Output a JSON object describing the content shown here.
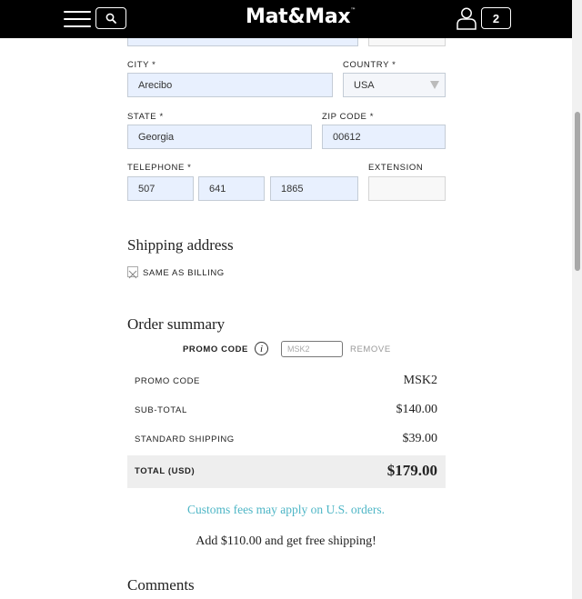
{
  "header": {
    "logo": "Mat&Max",
    "trademark": "™",
    "cart_count": "2"
  },
  "form": {
    "city": {
      "label": "CITY *",
      "value": "Arecibo"
    },
    "country": {
      "label": "COUNTRY *",
      "value": "USA"
    },
    "state": {
      "label": "STATE *",
      "value": "Georgia"
    },
    "zip": {
      "label": "ZIP CODE *",
      "value": "00612"
    },
    "telephone": {
      "label": "TELEPHONE *",
      "part1": "507",
      "part2": "641",
      "part3": "1865"
    },
    "extension": {
      "label": "EXTENSION",
      "value": ""
    }
  },
  "shipping": {
    "title": "Shipping address",
    "same_as_billing": "SAME AS BILLING"
  },
  "summary": {
    "title": "Order summary",
    "promo_label": "PROMO CODE",
    "promo_placeholder": "MSK2",
    "remove": "REMOVE",
    "rows": [
      {
        "label": "PROMO CODE",
        "value": "MSK2"
      },
      {
        "label": "SUB-TOTAL",
        "value": "$140.00"
      },
      {
        "label": "STANDARD SHIPPING",
        "value": "$39.00"
      }
    ],
    "total": {
      "label": "TOTAL (USD)",
      "value": "$179.00"
    }
  },
  "notices": {
    "customs": "Customs fees may apply on U.S. orders.",
    "free_shipping": "Add $110.00 and get free shipping!"
  },
  "comments": {
    "title": "Comments"
  },
  "colors": {
    "header_bg": "#000000",
    "field_bg": "#e8f0fe",
    "accent_teal": "#4eb6c6",
    "total_bg": "#eeeeee"
  }
}
